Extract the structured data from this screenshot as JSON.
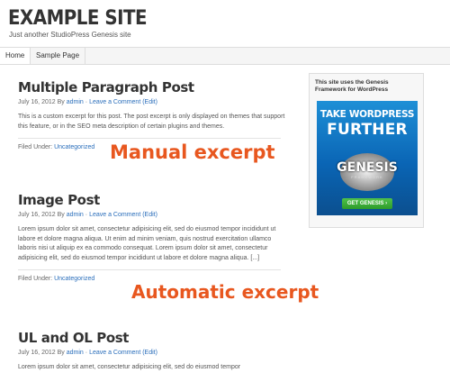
{
  "site": {
    "title": "EXAMPLE SITE",
    "description": "Just another StudioPress Genesis site"
  },
  "nav": {
    "items": [
      {
        "label": "Home"
      },
      {
        "label": "Sample Page"
      }
    ]
  },
  "posts": [
    {
      "title": "Multiple Paragraph Post",
      "date": "July 16, 2012",
      "by": "By",
      "author": "admin",
      "sep": "·",
      "comment_link": "Leave a Comment",
      "edit_link": "(Edit)",
      "body": "This is a custom excerpt for this post. The post excerpt is only displayed on themes that support this feature, or in the SEO meta description of certain plugins and themes.",
      "filed_under": "Filed Under:",
      "category": "Uncategorized"
    },
    {
      "title": "Image Post",
      "date": "July 16, 2012",
      "by": "By",
      "author": "admin",
      "sep": "·",
      "comment_link": "Leave a Comment",
      "edit_link": "(Edit)",
      "body": "Lorem ipsum dolor sit amet, consectetur adipisicing elit, sed do eiusmod tempor incididunt ut labore et dolore magna aliqua. Ut enim ad minim veniam, quis nostrud exercitation ullamco laboris nisi ut aliquip ex ea commodo consequat. Lorem ipsum dolor sit amet, consectetur adipisicing elit, sed do eiusmod tempor incididunt ut labore et dolore magna aliqua. [...]",
      "filed_under": "Filed Under:",
      "category": "Uncategorized"
    },
    {
      "title": "UL and OL Post",
      "date": "July 16, 2012",
      "by": "By",
      "author": "admin",
      "sep": "·",
      "comment_link": "Leave a Comment",
      "edit_link": "(Edit)",
      "body": "Lorem ipsum dolor sit amet, consectetur adipisicing elit, sed do eiusmod tempor"
    }
  ],
  "annotations": {
    "manual": "Manual excerpt",
    "automatic": "Automatic excerpt"
  },
  "sidebar": {
    "widget_text": "This site uses the Genesis Framework for WordPress",
    "banner": {
      "line1": "TAKE WORDPRESS",
      "line2": "FURTHER",
      "logo_text": "GENESIS",
      "logo_sub": "FRAMEWORK",
      "button": "GET GENESIS",
      "button_arrow": "›"
    }
  },
  "colors": {
    "accent_orange": "#e8571f",
    "link_blue": "#2a6ebb",
    "banner_blue": "#1e8fd6",
    "button_green": "#3bb036"
  }
}
